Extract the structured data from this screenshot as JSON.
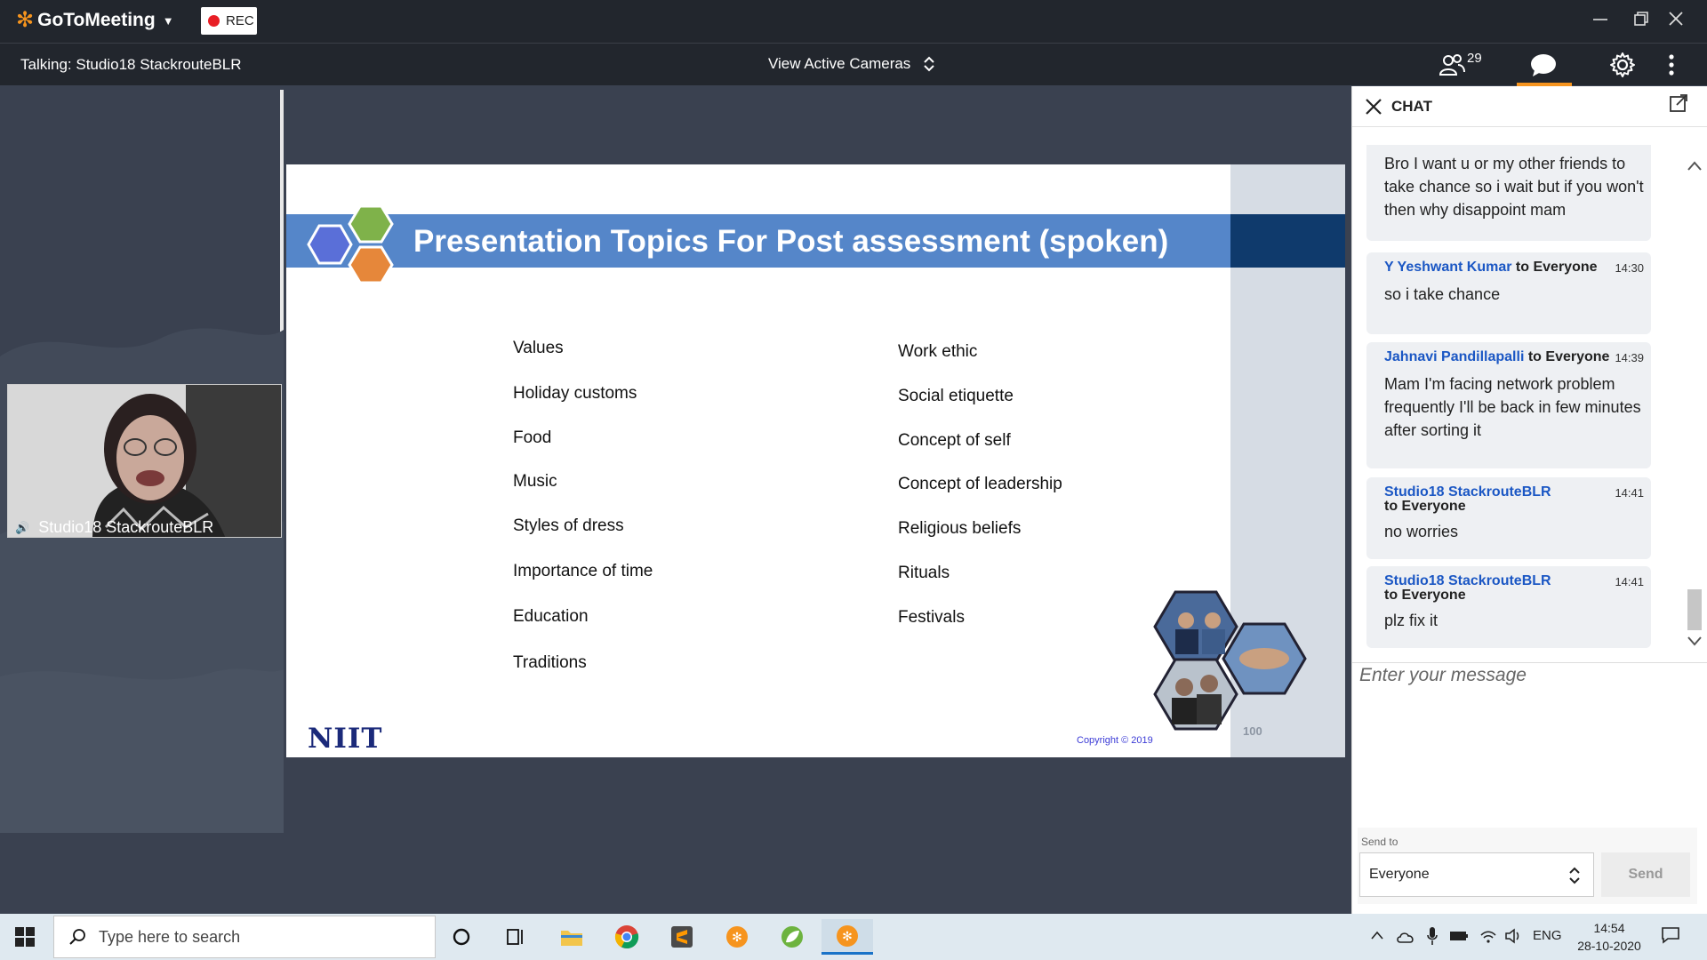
{
  "app": {
    "name": "GoToMeeting",
    "rec_label": "REC",
    "window_controls": [
      "minimize-icon",
      "restore-icon",
      "close-icon"
    ]
  },
  "toolbar": {
    "talking": "Talking: Studio18 StackrouteBLR",
    "view_cameras": "View Active Cameras",
    "attendees_count": "29"
  },
  "video": {
    "participant_name": "Studio18 StackrouteBLR"
  },
  "slide": {
    "title": "Presentation Topics For Post assessment (spoken)",
    "left_topics": [
      "Values",
      "Holiday customs",
      "Food",
      "Music",
      "Styles of dress",
      "Importance of time",
      "Education",
      "Traditions"
    ],
    "right_topics": [
      "Work ethic",
      "Social etiquette",
      "Concept of self",
      "Concept of leadership",
      "Religious beliefs",
      "Rituals",
      "Festivals"
    ],
    "logo_text": "NIIT",
    "copyright": "Copyright © 2019",
    "page_number": "100"
  },
  "chat": {
    "title": "CHAT",
    "messages": [
      {
        "sender": "",
        "to": "",
        "time": "",
        "body": "Bro I want u or my other friends to take chance so i wait but if you won't then why disappoint mam"
      },
      {
        "sender": "Y Yeshwant Kumar",
        "to": "to Everyone",
        "time": "14:30",
        "body": "so i take chance"
      },
      {
        "sender": "Jahnavi Pandillapalli",
        "to": "to Everyone",
        "time": "14:39",
        "body": "Mam I'm facing network problem frequently I'll be back in few minutes after sorting it"
      },
      {
        "sender": "Studio18 StackrouteBLR",
        "to": "to Everyone",
        "time": "14:41",
        "body": "no worries"
      },
      {
        "sender": "Studio18 StackrouteBLR",
        "to": "to Everyone",
        "time": "14:41",
        "body": "plz fix it"
      }
    ],
    "input_placeholder": "Enter your message",
    "send_to_label": "Send to",
    "send_to_value": "Everyone",
    "send_button": "Send"
  },
  "taskbar": {
    "search_placeholder": "Type here to search",
    "language": "ENG",
    "time": "14:54",
    "date": "28-10-2020"
  },
  "colors": {
    "brand_orange": "#f6941e",
    "chat_sender_blue": "#1b57c4",
    "slide_banner": "#5586c9",
    "rec_red": "#e81e25"
  }
}
